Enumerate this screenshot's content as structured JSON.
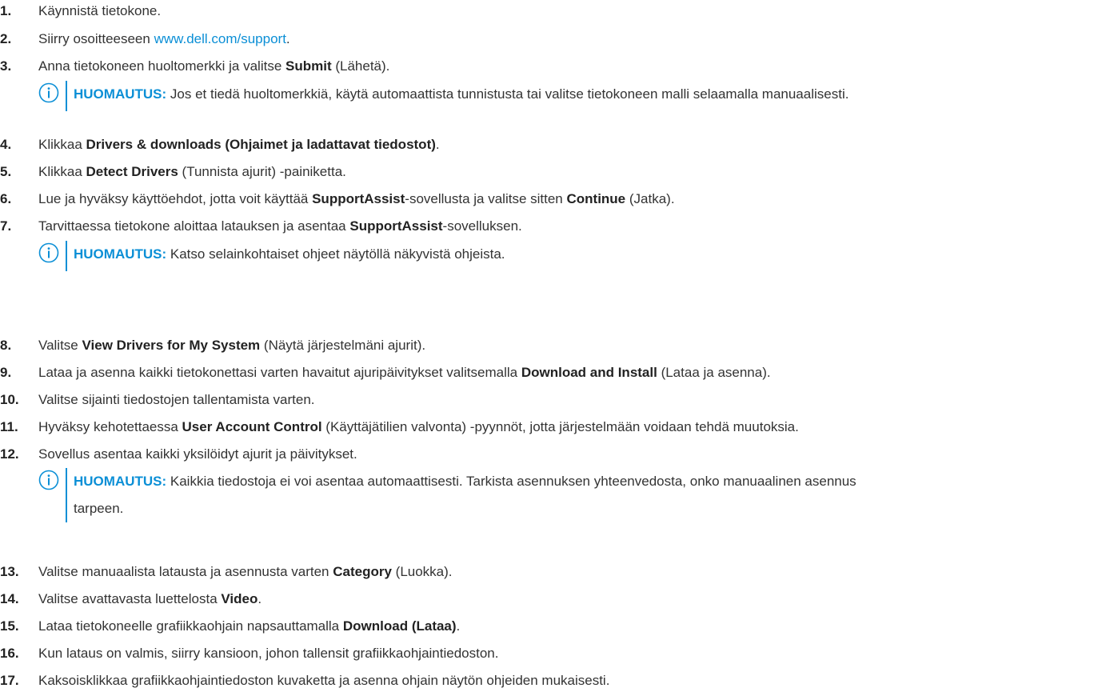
{
  "steps": [
    {
      "num": "1.",
      "segments": [
        {
          "t": "Käynnistä tietokone.",
          "s": "plain"
        }
      ]
    },
    {
      "num": "2.",
      "segments": [
        {
          "t": "Siirry osoitteeseen ",
          "s": "plain"
        },
        {
          "t": "www.dell.com/support",
          "s": "link"
        },
        {
          "t": ".",
          "s": "plain"
        }
      ]
    },
    {
      "num": "3.",
      "segments": [
        {
          "t": "Anna tietokoneen huoltomerkki ja valitse ",
          "s": "plain"
        },
        {
          "t": "Submit",
          "s": "bold"
        },
        {
          "t": " (Lähetä).",
          "s": "plain"
        }
      ]
    },
    {
      "num": "4.",
      "segments": [
        {
          "t": "Klikkaa ",
          "s": "plain"
        },
        {
          "t": "Drivers & downloads (Ohjaimet ja ladattavat tiedostot)",
          "s": "bold"
        },
        {
          "t": ".",
          "s": "plain"
        }
      ]
    },
    {
      "num": "5.",
      "segments": [
        {
          "t": "Klikkaa ",
          "s": "plain"
        },
        {
          "t": "Detect Drivers",
          "s": "bold"
        },
        {
          "t": " (Tunnista ajurit) -painiketta.",
          "s": "plain"
        }
      ]
    },
    {
      "num": "6.",
      "segments": [
        {
          "t": "Lue ja hyväksy käyttöehdot, jotta voit käyttää ",
          "s": "plain"
        },
        {
          "t": "SupportAssist",
          "s": "bold"
        },
        {
          "t": "-sovellusta ja valitse sitten ",
          "s": "plain"
        },
        {
          "t": "Continue",
          "s": "bold"
        },
        {
          "t": " (Jatka).",
          "s": "plain"
        }
      ]
    },
    {
      "num": "7.",
      "segments": [
        {
          "t": "Tarvittaessa tietokone aloittaa latauksen ja asentaa ",
          "s": "plain"
        },
        {
          "t": "SupportAssist",
          "s": "bold"
        },
        {
          "t": "-sovelluksen.",
          "s": "plain"
        }
      ]
    },
    {
      "num": "8.",
      "segments": [
        {
          "t": "Valitse ",
          "s": "plain"
        },
        {
          "t": "View Drivers for My System",
          "s": "bold"
        },
        {
          "t": " (Näytä järjestelmäni ajurit).",
          "s": "plain"
        }
      ]
    },
    {
      "num": "9.",
      "segments": [
        {
          "t": "Lataa ja asenna kaikki tietokonettasi varten havaitut ajuripäivitykset valitsemalla ",
          "s": "plain"
        },
        {
          "t": "Download and Install",
          "s": "bold"
        },
        {
          "t": " (Lataa ja asenna).",
          "s": "plain"
        }
      ]
    },
    {
      "num": "10.",
      "segments": [
        {
          "t": "Valitse sijainti tiedostojen tallentamista varten.",
          "s": "plain"
        }
      ]
    },
    {
      "num": "11.",
      "segments": [
        {
          "t": "Hyväksy kehotettaessa ",
          "s": "plain"
        },
        {
          "t": "User Account Control",
          "s": "bold"
        },
        {
          "t": " (Käyttäjätilien valvonta) -pyynnöt, jotta järjestelmään voidaan tehdä muutoksia.",
          "s": "plain"
        }
      ]
    },
    {
      "num": "12.",
      "segments": [
        {
          "t": "Sovellus asentaa kaikki yksilöidyt ajurit ja päivitykset.",
          "s": "plain"
        }
      ]
    },
    {
      "num": "13.",
      "segments": [
        {
          "t": "Valitse manuaalista latausta ja asennusta varten ",
          "s": "plain"
        },
        {
          "t": "Category",
          "s": "bold"
        },
        {
          "t": " (Luokka).",
          "s": "plain"
        }
      ]
    },
    {
      "num": "14.",
      "segments": [
        {
          "t": "Valitse avattavasta luettelosta ",
          "s": "plain"
        },
        {
          "t": "Video",
          "s": "bold"
        },
        {
          "t": ".",
          "s": "plain"
        }
      ]
    },
    {
      "num": "15.",
      "segments": [
        {
          "t": "Lataa tietokoneelle grafiikkaohjain napsauttamalla ",
          "s": "plain"
        },
        {
          "t": "Download (Lataa)",
          "s": "bold"
        },
        {
          "t": ".",
          "s": "plain"
        }
      ]
    },
    {
      "num": "16.",
      "segments": [
        {
          "t": "Kun lataus on valmis, siirry kansioon, johon tallensit grafiikkaohjaintiedoston.",
          "s": "plain"
        }
      ]
    },
    {
      "num": "17.",
      "segments": [
        {
          "t": "Kaksoisklikkaa grafiikkaohjaintiedoston kuvaketta ja asenna ohjain näytön ohjeiden mukaisesti.",
          "s": "plain"
        }
      ]
    }
  ],
  "notes": [
    {
      "label": "HUOMAUTUS:",
      "lines": [
        "Jos et tiedä huoltomerkkiä, käytä automaattista tunnistusta tai valitse tietokoneen malli selaamalla manuaalisesti."
      ]
    },
    {
      "label": "HUOMAUTUS:",
      "lines": [
        "Katso selainkohtaiset ohjeet näytöllä näkyvistä ohjeista."
      ]
    },
    {
      "label": "HUOMAUTUS:",
      "lines": [
        "Kaikkia tiedostoja ei voi asentaa automaattisesti. Tarkista asennuksen yhteenvedosta, onko manuaalinen asennus",
        "tarpeen."
      ]
    }
  ],
  "note_icon": "info-icon",
  "colors": {
    "accent": "#0b8fd6",
    "text": "#333333"
  }
}
